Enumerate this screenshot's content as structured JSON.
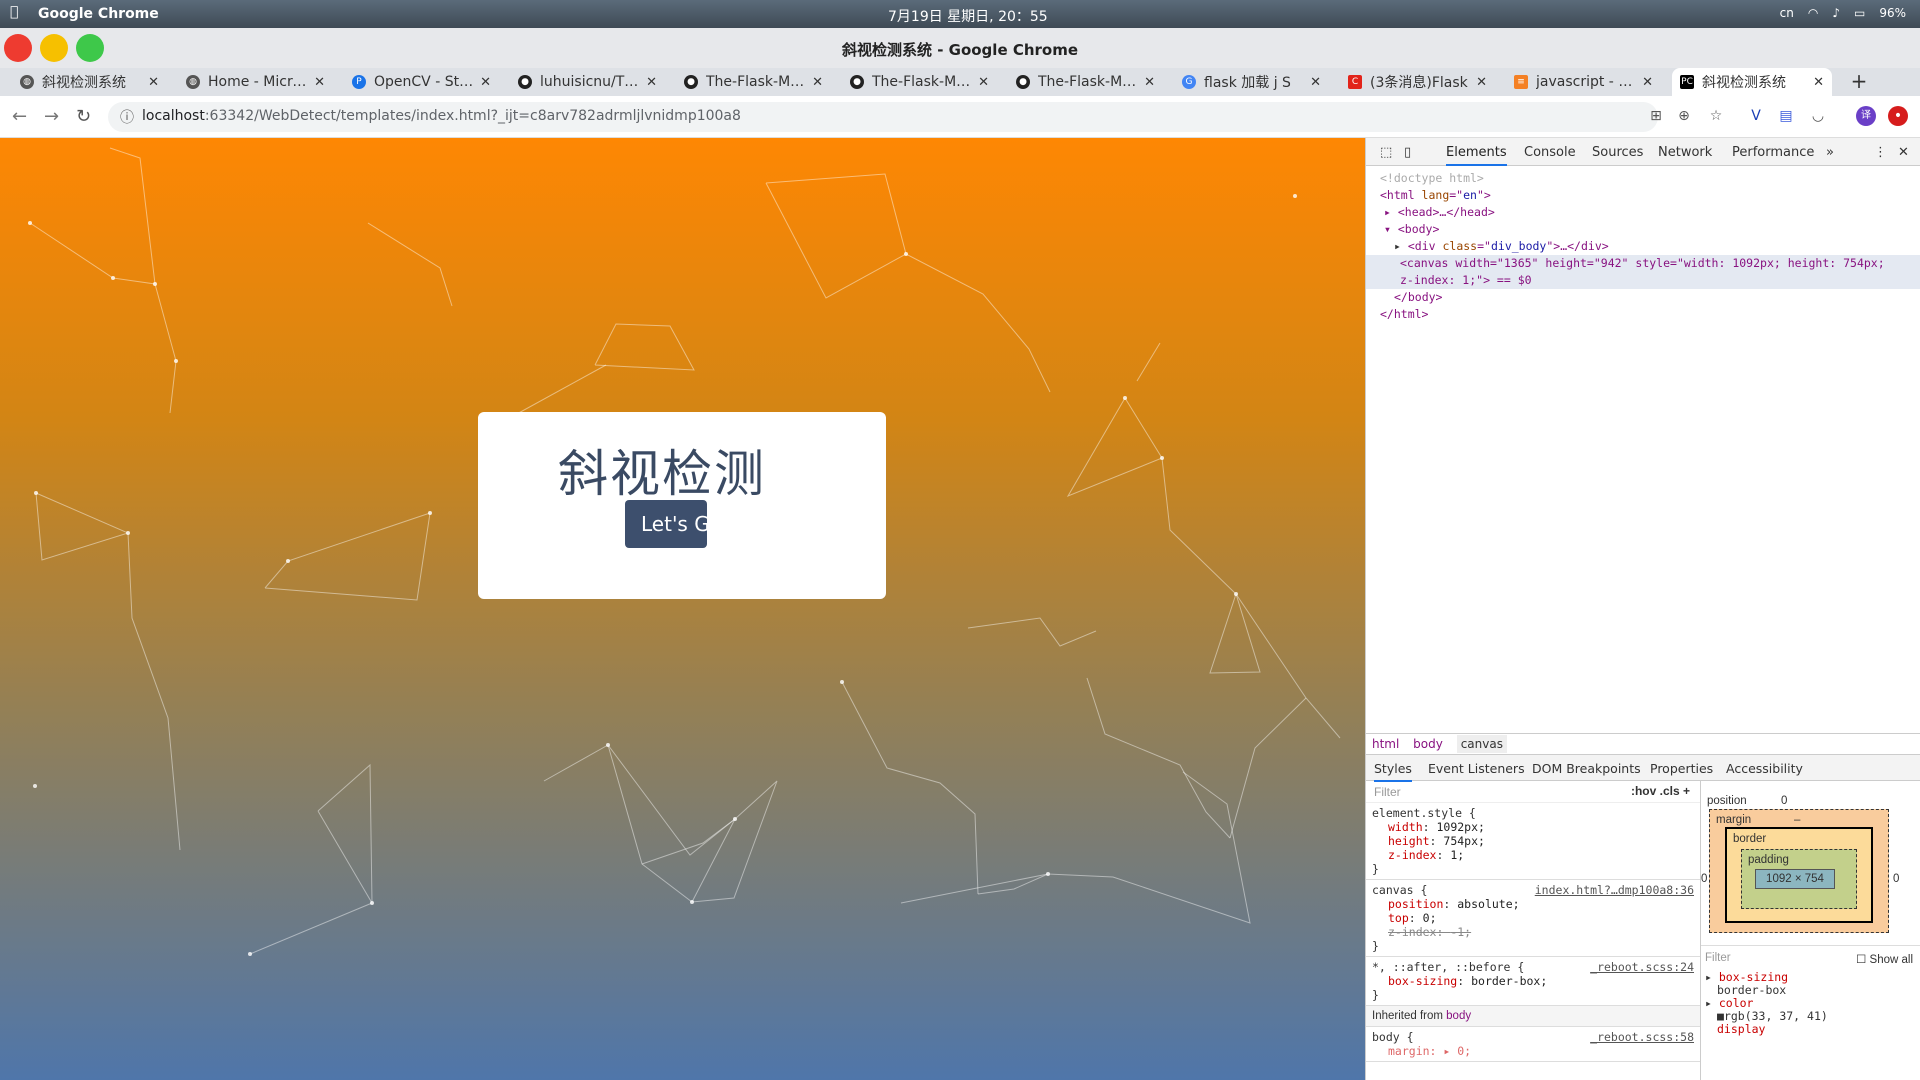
{
  "menubar": {
    "app": "Google Chrome",
    "clock": "7月19日 星期日, 20：55",
    "lang": "cn",
    "battery": "96%"
  },
  "window": {
    "title": "斜视检测系统 - Google Chrome"
  },
  "tabs": [
    {
      "label": "斜视检测系统",
      "fav": "globe-icon"
    },
    {
      "label": "Home - Microsoft",
      "fav": "globe-icon"
    },
    {
      "label": "OpenCV - Stream",
      "fav": "p-icon"
    },
    {
      "label": "luhuisicnu/The-",
      "fav": "github-icon"
    },
    {
      "label": "The-Flask-Mega",
      "fav": "github-icon"
    },
    {
      "label": "The-Flask-Mega",
      "fav": "github-icon"
    },
    {
      "label": "The-Flask-Mega",
      "fav": "github-icon"
    },
    {
      "label": "flask 加载 j S",
      "fav": "google-icon"
    },
    {
      "label": "(3条消息)Flask",
      "fav": "csdn-icon"
    },
    {
      "label": "javascript - Pul",
      "fav": "stackoverflow-icon"
    },
    {
      "label": "斜视检测系统",
      "fav": "pycharm-icon"
    }
  ],
  "url": {
    "host": "localhost",
    "path": ":63342/WebDetect/templates/index.html?_ijt=c8arv782adrmljlvnidmp100a8"
  },
  "page": {
    "heading": "斜视检测",
    "button": "Let's Go"
  },
  "devtools": {
    "tabs": [
      "Elements",
      "Console",
      "Sources",
      "Network",
      "Performance"
    ],
    "dom": {
      "l1": "<!doctype html>",
      "l2a": "<html ",
      "l2b": "lang",
      "l2c": "=\"",
      "l2d": "en",
      "l2e": "\">",
      "l3": "<head>…</head>",
      "l4": "<body>",
      "l5a": "<div ",
      "l5b": "class",
      "l5c": "=\"",
      "l5d": "div_body",
      "l5e": "\">…</div>",
      "l6": "<canvas width=\"1365\" height=\"942\" style=\"width: 1092px; height: 754px;",
      "l6b": "z-index: 1;\"> == $0",
      "l7": "</body>",
      "l8": "</html>"
    },
    "crumbs": [
      "html",
      "body",
      "canvas"
    ],
    "subtabs": [
      "Styles",
      "Event Listeners",
      "DOM Breakpoints",
      "Properties",
      "Accessibility"
    ],
    "filter": "Filter",
    "hov": ":hov",
    "cls": ".cls",
    "rules": [
      {
        "sel": "element.style {",
        "src": "",
        "props": [
          [
            "width",
            "1092px;"
          ],
          [
            "height",
            "754px;"
          ],
          [
            "z-index",
            "1;"
          ]
        ]
      },
      {
        "sel": "canvas {",
        "src": "index.html?…dmp100a8:36",
        "props": [
          [
            "position",
            "absolute;"
          ],
          [
            "top",
            "0;"
          ],
          [
            "z-index",
            "-1;"
          ]
        ]
      },
      {
        "sel": "*, ::after, ::before {",
        "src": "_reboot.scss:24",
        "props": [
          [
            "box-sizing",
            "border-box;"
          ]
        ]
      }
    ],
    "inherited": "Inherited from",
    "inheritedFrom": "body",
    "bodyRule": {
      "sel": "body {",
      "src": "_reboot.scss:58",
      "p": "margin:",
      "v": "▸ 0;"
    },
    "box": {
      "position": "position",
      "posval": "0",
      "margin": "margin",
      "border": "border",
      "padding": "padding",
      "content": "1092 × 754",
      "dash": "–",
      "zero": "0"
    },
    "computed": {
      "filter": "Filter",
      "showall": "Show all",
      "p1": "box-sizing",
      "v1": "border-box",
      "p2": "color",
      "v2": "rgb(33, 37, 41)",
      "p3": "display"
    }
  }
}
